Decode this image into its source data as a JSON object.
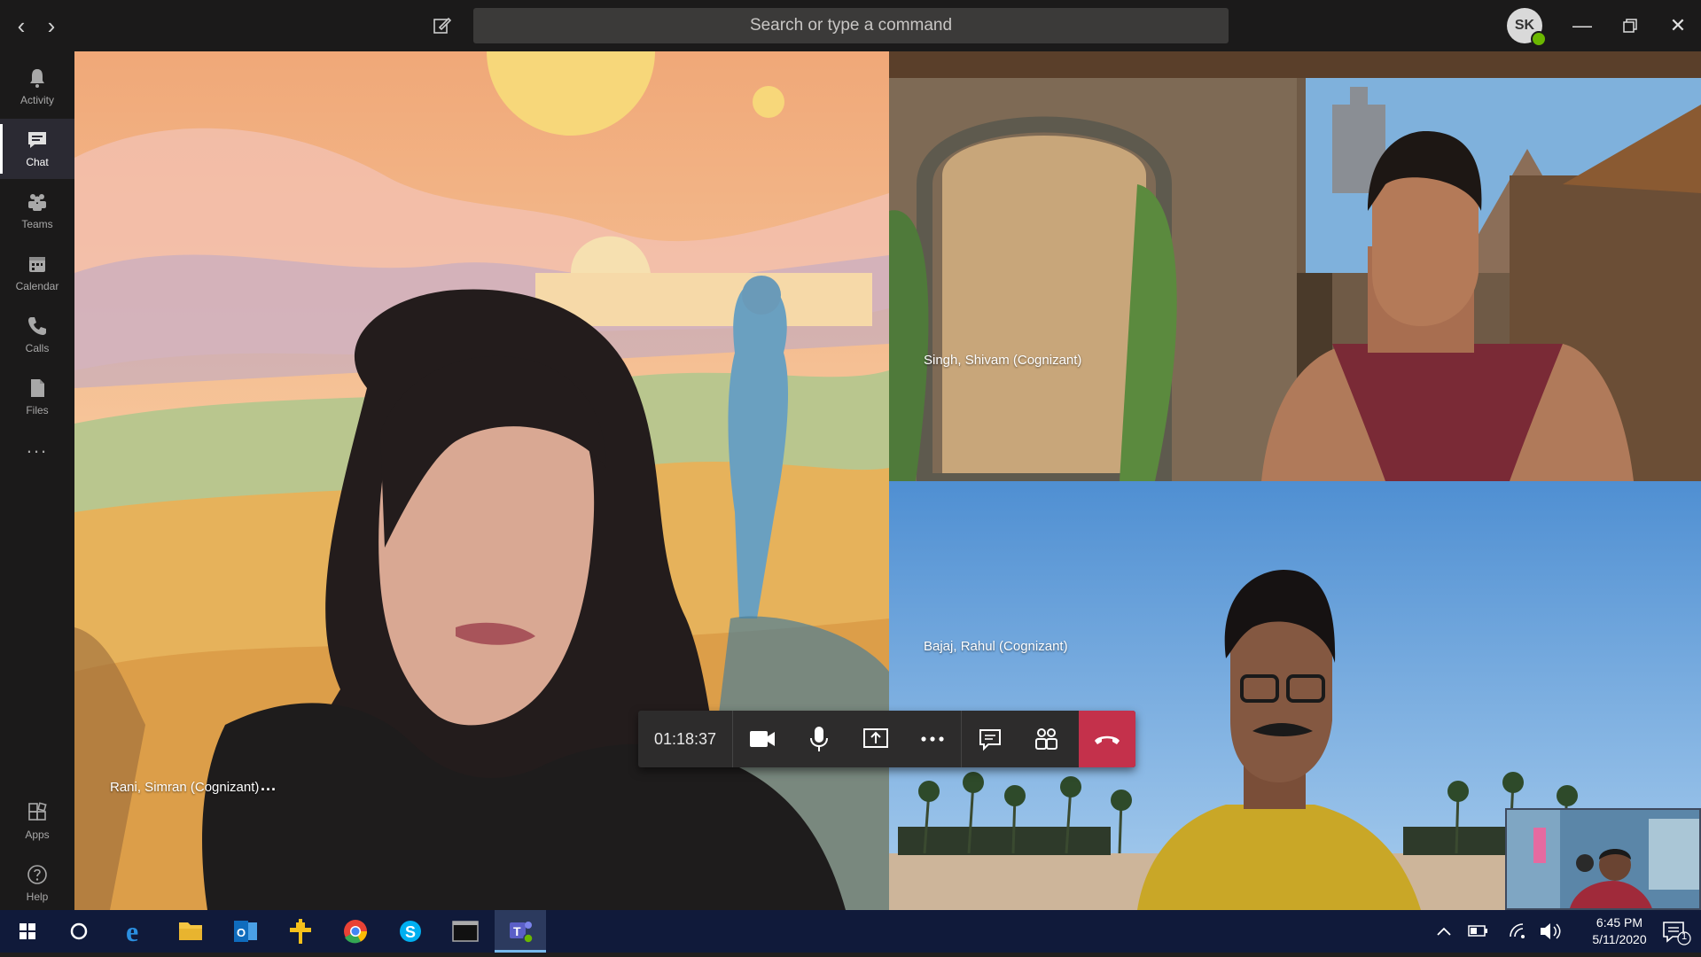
{
  "search": {
    "placeholder": "Search or type a command"
  },
  "user": {
    "initials": "SK"
  },
  "rail": {
    "items": [
      {
        "label": "Activity",
        "icon": "bell-icon"
      },
      {
        "label": "Chat",
        "icon": "chat-icon",
        "active": true
      },
      {
        "label": "Teams",
        "icon": "teams-icon"
      },
      {
        "label": "Calendar",
        "icon": "calendar-icon"
      },
      {
        "label": "Calls",
        "icon": "phone-icon"
      },
      {
        "label": "Files",
        "icon": "file-icon"
      }
    ],
    "more": "...",
    "bottom": [
      {
        "label": "Apps",
        "icon": "apps-icon"
      },
      {
        "label": "Help",
        "icon": "help-icon"
      }
    ]
  },
  "participants": [
    {
      "name": "Rani, Simran (Cognizant)",
      "more": "..."
    },
    {
      "name": "Singh, Shivam (Cognizant)"
    },
    {
      "name": "Bajaj, Rahul (Cognizant)"
    }
  ],
  "call": {
    "duration": "01:18:37"
  },
  "taskbar": {
    "time": "6:45 PM",
    "date": "5/11/2020",
    "notifications": "1"
  },
  "colors": {
    "hangup": "#c4314b",
    "presence": "#6bb700",
    "taskbar": "#101a3a"
  }
}
